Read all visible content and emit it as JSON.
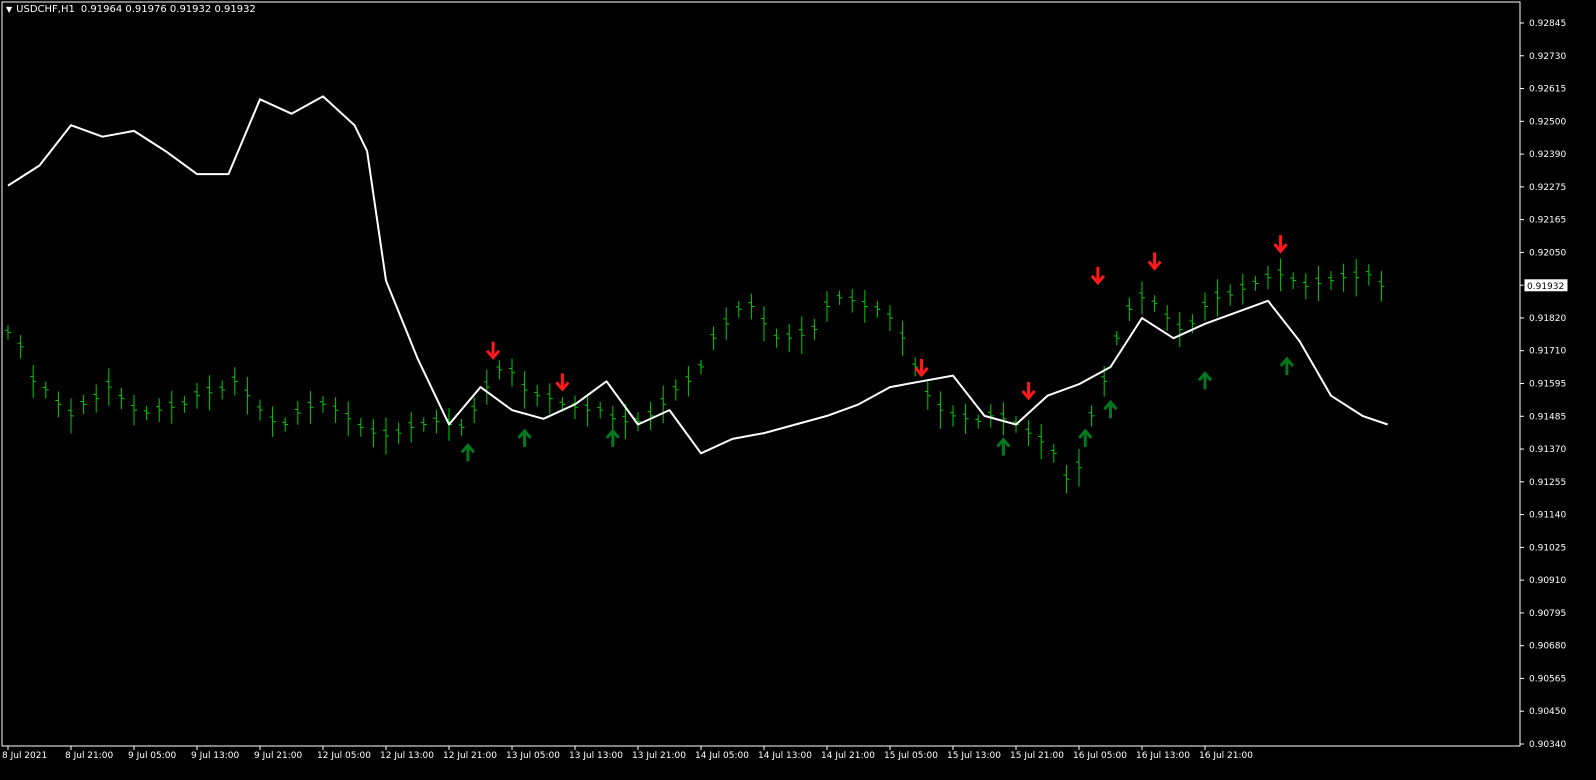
{
  "header": {
    "symbol": "USDCHF,H1",
    "ohlc": "0.91964 0.91976 0.91932 0.91932"
  },
  "colors": {
    "background": "#000000",
    "bars": "#00cc00",
    "line": "#ffffff",
    "arrow_up": "#007a1e",
    "arrow_down": "#ff1a1a",
    "frame": "#ffffff"
  },
  "chart_data": {
    "type": "line",
    "symbol": "USDCHF",
    "timeframe": "H1",
    "y_ticks": [
      "0.92845",
      "0.92730",
      "0.92615",
      "0.92500",
      "0.92390",
      "0.92275",
      "0.92165",
      "0.92050",
      "0.91935",
      "0.91820",
      "0.91710",
      "0.91595",
      "0.91485",
      "0.91370",
      "0.91255",
      "0.91140",
      "0.91025",
      "0.90910",
      "0.90795",
      "0.90680",
      "0.90565",
      "0.90450",
      "0.90340"
    ],
    "ylim": [
      0.9034,
      0.92845
    ],
    "x_ticks": [
      "8 Jul 2021",
      "8 Jul 21:00",
      "9 Jul 05:00",
      "9 Jul 13:00",
      "9 Jul 21:00",
      "12 Jul 05:00",
      "12 Jul 13:00",
      "12 Jul 21:00",
      "13 Jul 05:00",
      "13 Jul 13:00",
      "13 Jul 21:00",
      "14 Jul 05:00",
      "14 Jul 13:00",
      "14 Jul 21:00",
      "15 Jul 05:00",
      "15 Jul 13:00",
      "15 Jul 21:00",
      "16 Jul 05:00",
      "16 Jul 13:00",
      "16 Jul 21:00"
    ],
    "current_price": "0.91932",
    "bars": [
      [
        0,
        0.9177
      ],
      [
        0.2,
        0.9172
      ],
      [
        0.4,
        0.916
      ],
      [
        0.6,
        0.9157
      ],
      [
        0.8,
        0.9152
      ],
      [
        1,
        0.9148
      ],
      [
        1.2,
        0.9152
      ],
      [
        1.4,
        0.9154
      ],
      [
        1.6,
        0.9158
      ],
      [
        1.8,
        0.9154
      ],
      [
        2,
        0.915
      ],
      [
        2.2,
        0.9149
      ],
      [
        2.4,
        0.915
      ],
      [
        2.6,
        0.9151
      ],
      [
        2.8,
        0.9152
      ],
      [
        3,
        0.9155
      ],
      [
        3.2,
        0.9156
      ],
      [
        3.4,
        0.9157
      ],
      [
        3.6,
        0.916
      ],
      [
        3.8,
        0.9155
      ],
      [
        4,
        0.915
      ],
      [
        4.2,
        0.9146
      ],
      [
        4.4,
        0.9145
      ],
      [
        4.6,
        0.9149
      ],
      [
        4.8,
        0.9151
      ],
      [
        5,
        0.9152
      ],
      [
        5.2,
        0.915
      ],
      [
        5.4,
        0.9147
      ],
      [
        5.6,
        0.9144
      ],
      [
        5.8,
        0.9142
      ],
      [
        6,
        0.9141
      ],
      [
        6.2,
        0.9142
      ],
      [
        6.4,
        0.9144
      ],
      [
        6.6,
        0.9145
      ],
      [
        6.8,
        0.9146
      ],
      [
        7,
        0.9145
      ],
      [
        7.2,
        0.9144
      ],
      [
        7.4,
        0.915
      ],
      [
        7.6,
        0.9158
      ],
      [
        7.8,
        0.9164
      ],
      [
        8,
        0.9163
      ],
      [
        8.2,
        0.9157
      ],
      [
        8.4,
        0.9155
      ],
      [
        8.6,
        0.9154
      ],
      [
        8.8,
        0.9152
      ],
      [
        9,
        0.9151
      ],
      [
        9.2,
        0.915
      ],
      [
        9.4,
        0.915
      ],
      [
        9.6,
        0.9147
      ],
      [
        9.8,
        0.9146
      ],
      [
        10,
        0.9146
      ],
      [
        10.2,
        0.9148
      ],
      [
        10.4,
        0.9152
      ],
      [
        10.6,
        0.9157
      ],
      [
        10.8,
        0.916
      ],
      [
        11,
        0.9165
      ],
      [
        11.2,
        0.9175
      ],
      [
        11.4,
        0.918
      ],
      [
        11.6,
        0.9185
      ],
      [
        11.8,
        0.9186
      ],
      [
        12,
        0.918
      ],
      [
        12.2,
        0.9175
      ],
      [
        12.4,
        0.9175
      ],
      [
        12.6,
        0.9176
      ],
      [
        12.8,
        0.9178
      ],
      [
        13,
        0.9186
      ],
      [
        13.2,
        0.9189
      ],
      [
        13.4,
        0.9188
      ],
      [
        13.6,
        0.9186
      ],
      [
        13.8,
        0.9185
      ],
      [
        14,
        0.9182
      ],
      [
        14.2,
        0.9175
      ],
      [
        14.4,
        0.9165
      ],
      [
        14.6,
        0.9155
      ],
      [
        14.8,
        0.915
      ],
      [
        15,
        0.9148
      ],
      [
        15.2,
        0.9147
      ],
      [
        15.4,
        0.9146
      ],
      [
        15.6,
        0.9148
      ],
      [
        15.8,
        0.9147
      ],
      [
        16,
        0.9145
      ],
      [
        16.2,
        0.9142
      ],
      [
        16.4,
        0.9139
      ],
      [
        16.6,
        0.9135
      ],
      [
        16.8,
        0.9126
      ],
      [
        17,
        0.913
      ],
      [
        17.2,
        0.9148
      ],
      [
        17.4,
        0.916
      ],
      [
        17.6,
        0.9175
      ],
      [
        17.8,
        0.9185
      ],
      [
        18,
        0.9189
      ],
      [
        18.2,
        0.9187
      ],
      [
        18.4,
        0.9182
      ],
      [
        18.6,
        0.9178
      ],
      [
        18.8,
        0.918
      ],
      [
        19,
        0.9186
      ],
      [
        19.2,
        0.9189
      ],
      [
        19.4,
        0.919
      ],
      [
        19.6,
        0.9192
      ],
      [
        19.8,
        0.9194
      ],
      [
        20,
        0.9196
      ],
      [
        20.2,
        0.9197
      ],
      [
        20.4,
        0.9195
      ],
      [
        20.6,
        0.9193
      ],
      [
        20.8,
        0.9194
      ],
      [
        21,
        0.9195
      ],
      [
        21.2,
        0.9196
      ],
      [
        21.4,
        0.9196
      ],
      [
        21.6,
        0.9197
      ],
      [
        21.8,
        0.9193
      ]
    ],
    "line": [
      [
        0,
        0.9228
      ],
      [
        0.5,
        0.9235
      ],
      [
        1,
        0.9249
      ],
      [
        1.5,
        0.9245
      ],
      [
        2,
        0.9247
      ],
      [
        2.5,
        0.924
      ],
      [
        3,
        0.9232
      ],
      [
        3.5,
        0.9232
      ],
      [
        4,
        0.9258
      ],
      [
        4.5,
        0.9253
      ],
      [
        5,
        0.9259
      ],
      [
        5.5,
        0.9249
      ],
      [
        5.7,
        0.924
      ],
      [
        6,
        0.9195
      ],
      [
        6.5,
        0.9168
      ],
      [
        7,
        0.9145
      ],
      [
        7.5,
        0.9158
      ],
      [
        8,
        0.915
      ],
      [
        8.5,
        0.9147
      ],
      [
        9,
        0.9152
      ],
      [
        9.5,
        0.916
      ],
      [
        10,
        0.9145
      ],
      [
        10.5,
        0.915
      ],
      [
        11,
        0.9135
      ],
      [
        11.5,
        0.914
      ],
      [
        12,
        0.9142
      ],
      [
        12.5,
        0.9145
      ],
      [
        13,
        0.9148
      ],
      [
        13.5,
        0.9152
      ],
      [
        14,
        0.9158
      ],
      [
        14.5,
        0.916
      ],
      [
        15,
        0.9162
      ],
      [
        15.5,
        0.9148
      ],
      [
        16,
        0.9145
      ],
      [
        16.5,
        0.9155
      ],
      [
        17,
        0.9159
      ],
      [
        17.5,
        0.9165
      ],
      [
        18,
        0.9182
      ],
      [
        18.5,
        0.9175
      ],
      [
        19,
        0.918
      ],
      [
        19.5,
        0.9184
      ],
      [
        20,
        0.9188
      ],
      [
        20.5,
        0.9174
      ],
      [
        21,
        0.9155
      ],
      [
        21.5,
        0.9148
      ],
      [
        21.9,
        0.9145
      ]
    ],
    "arrows_up": [
      [
        7.3,
        0.9135
      ],
      [
        8.2,
        0.914
      ],
      [
        9.6,
        0.914
      ],
      [
        15.8,
        0.9137
      ],
      [
        17.1,
        0.914
      ],
      [
        17.5,
        0.915
      ],
      [
        19,
        0.916
      ],
      [
        20.3,
        0.9165
      ]
    ],
    "arrows_down": [
      [
        7.7,
        0.9171
      ],
      [
        8.8,
        0.916
      ],
      [
        14.5,
        0.9165
      ],
      [
        16.2,
        0.9157
      ],
      [
        17.3,
        0.9197
      ],
      [
        18.2,
        0.9202
      ],
      [
        20.2,
        0.9208
      ]
    ]
  }
}
